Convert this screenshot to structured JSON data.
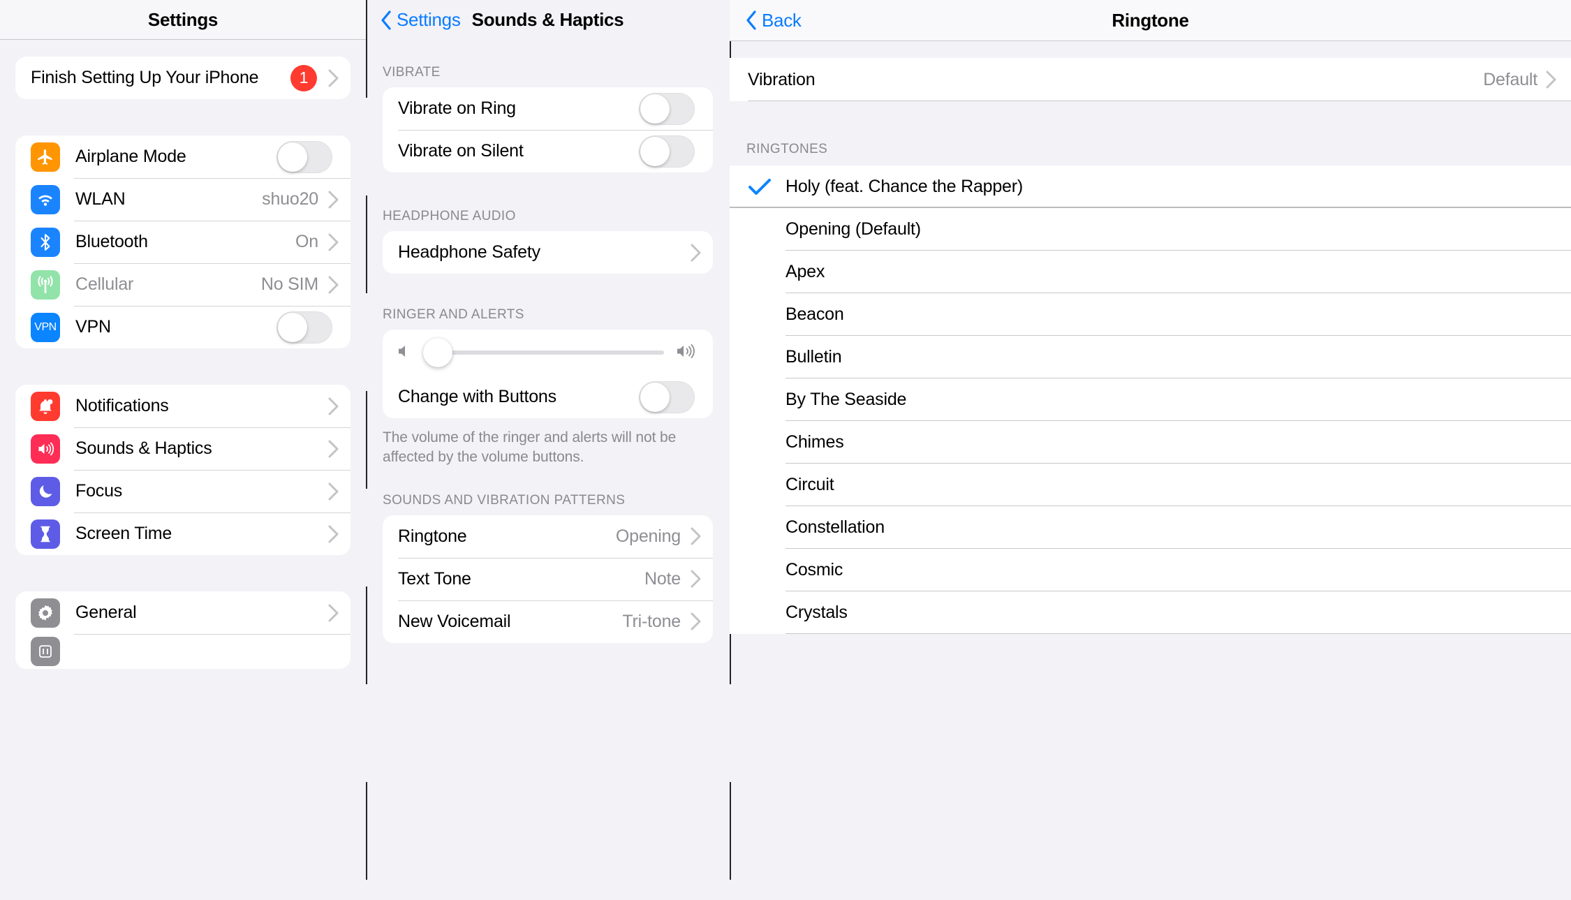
{
  "panel_settings": {
    "nav": {
      "title": "Settings"
    },
    "groups": [
      {
        "rows": [
          {
            "label": "Finish Setting Up Your iPhone",
            "badge": "1",
            "accessory": "chevron",
            "icon": null
          }
        ]
      },
      {
        "rows": [
          {
            "label": "Airplane Mode",
            "icon": "airplane-icon",
            "icon_color": "#ff9500",
            "accessory": "toggle-off"
          },
          {
            "label": "WLAN",
            "icon": "wifi-icon",
            "icon_color": "#1a84ff",
            "value": "shuo20",
            "accessory": "chevron"
          },
          {
            "label": "Bluetooth",
            "icon": "bluetooth-icon",
            "icon_color": "#1a84ff",
            "value": "On",
            "accessory": "chevron"
          },
          {
            "label": "Cellular",
            "dim": true,
            "icon": "cellular-icon",
            "icon_color": "#92e3a9",
            "value": "No SIM",
            "accessory": "chevron"
          },
          {
            "label": "VPN",
            "icon": "vpn-icon",
            "icon_color": "#0a84ff",
            "accessory": "toggle-off"
          }
        ]
      },
      {
        "rows": [
          {
            "label": "Notifications",
            "icon": "bell-icon",
            "icon_color": "#ff3b30",
            "accessory": "chevron"
          },
          {
            "label": "Sounds & Haptics",
            "icon": "speaker-icon",
            "icon_color": "#ff2d55",
            "accessory": "chevron"
          },
          {
            "label": "Focus",
            "icon": "moon-icon",
            "icon_color": "#5e5ce6",
            "accessory": "chevron"
          },
          {
            "label": "Screen Time",
            "icon": "hourglass-icon",
            "icon_color": "#5e5ce6",
            "accessory": "chevron"
          }
        ]
      },
      {
        "rows": [
          {
            "label": "General",
            "icon": "gear-icon",
            "icon_color": "#8e8e93",
            "accessory": "chevron"
          },
          {
            "label": "",
            "icon": "control-center-icon",
            "icon_color": "#8e8e93",
            "accessory": "chevron"
          }
        ]
      }
    ]
  },
  "panel_sounds": {
    "nav": {
      "back_label": "Settings",
      "title": "Sounds & Haptics"
    },
    "sections": [
      {
        "header": "VIBRATE",
        "rows": [
          {
            "label": "Vibrate on Ring",
            "accessory": "toggle-off"
          },
          {
            "label": "Vibrate on Silent",
            "accessory": "toggle-off"
          }
        ]
      },
      {
        "header": "HEADPHONE AUDIO",
        "rows": [
          {
            "label": "Headphone Safety",
            "accessory": "chevron"
          }
        ]
      },
      {
        "header": "RINGER AND ALERTS",
        "slider": {
          "value_percent": 5,
          "left_icon": "speaker-low-icon",
          "right_icon": "speaker-high-icon"
        },
        "rows": [
          {
            "label": "Change with Buttons",
            "accessory": "toggle-off"
          }
        ],
        "footnote": "The volume of the ringer and alerts will not be affected by the volume buttons."
      },
      {
        "header": "SOUNDS AND VIBRATION PATTERNS",
        "rows": [
          {
            "label": "Ringtone",
            "value": "Opening",
            "accessory": "chevron"
          },
          {
            "label": "Text Tone",
            "value": "Note",
            "accessory": "chevron"
          },
          {
            "label": "New Voicemail",
            "value": "Tri-tone",
            "accessory": "chevron"
          }
        ]
      }
    ]
  },
  "panel_ringtone": {
    "nav": {
      "back_label": "Back",
      "title": "Ringtone"
    },
    "vibration_row": {
      "label": "Vibration",
      "value": "Default",
      "accessory": "chevron"
    },
    "ringtones_header": "RINGTONES",
    "selected_tone": "Holy (feat. Chance the Rapper)",
    "tones": [
      {
        "label": "Holy (feat. Chance the Rapper)",
        "selected": true
      },
      {
        "label": "Opening (Default)",
        "selected": false
      },
      {
        "label": "Apex",
        "selected": false
      },
      {
        "label": "Beacon",
        "selected": false
      },
      {
        "label": "Bulletin",
        "selected": false
      },
      {
        "label": "By The Seaside",
        "selected": false
      },
      {
        "label": "Chimes",
        "selected": false
      },
      {
        "label": "Circuit",
        "selected": false
      },
      {
        "label": "Constellation",
        "selected": false
      },
      {
        "label": "Cosmic",
        "selected": false
      },
      {
        "label": "Crystals",
        "selected": false
      }
    ]
  },
  "colors": {
    "accent_blue": "#0a7cff",
    "badge_red": "#ff3b30",
    "check_blue": "#0a84ff",
    "background": "#f2f2f7"
  }
}
